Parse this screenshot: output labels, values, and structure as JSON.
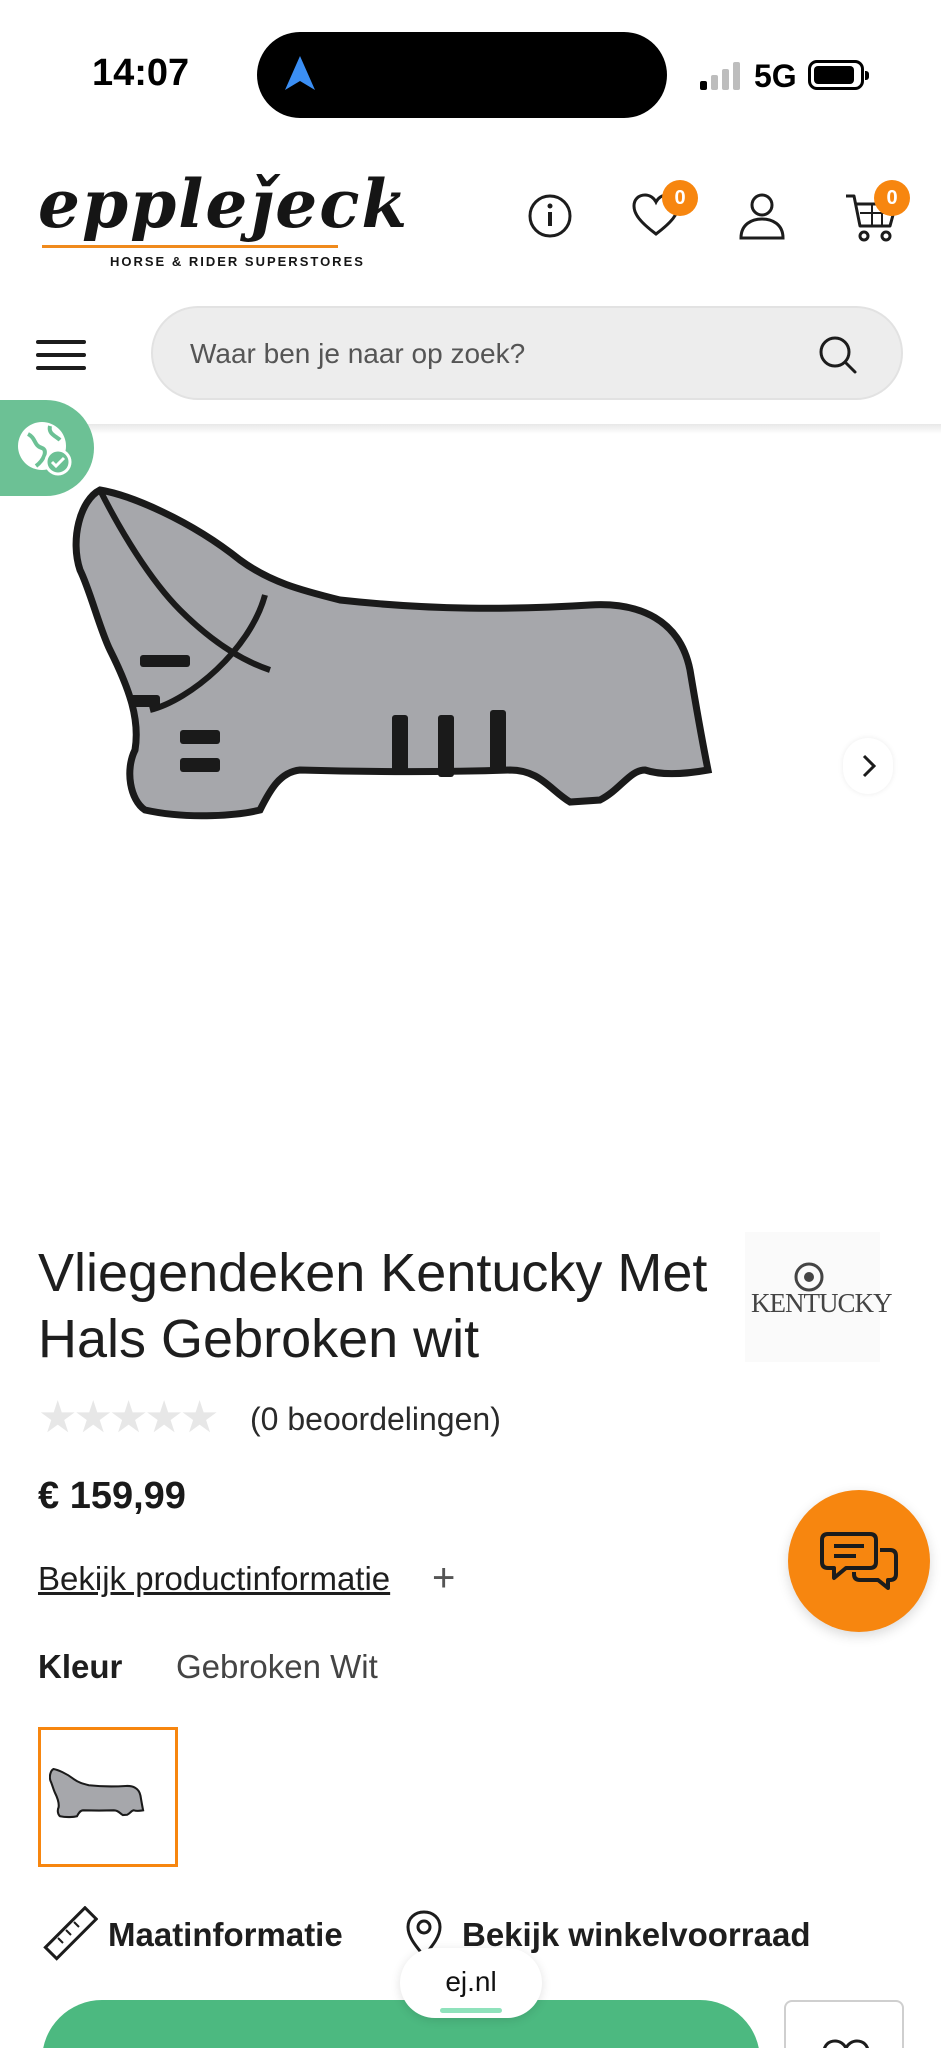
{
  "status_bar": {
    "time": "14:07",
    "network": "5G",
    "icons": [
      "location-arrow-icon",
      "signal-icon",
      "battery-icon"
    ]
  },
  "header": {
    "logo_text": "eppleǰeck",
    "logo_tagline": "HORSE & RIDER SUPERSTORES",
    "wishlist_count": "0",
    "cart_count": "0",
    "icons": [
      "info-icon",
      "heart-icon",
      "user-icon",
      "cart-icon"
    ],
    "accent_color": "#f7860f"
  },
  "search": {
    "placeholder": "Waar ben je naar op zoek?"
  },
  "product": {
    "title": "Vliegendeken Kentucky Met Hals Gebroken wit",
    "brand": "KENTUCKY",
    "reviews": "(0 beoordelingen)",
    "rating_stars": 0,
    "rating_max": 5,
    "price": "€ 159,99",
    "info_link": "Bekijk productinformatie",
    "color_label": "Kleur",
    "color_value": "Gebroken Wit",
    "size_info": "Maatinformatie",
    "stock_info": "Bekijk winkelvoorraad",
    "cta_color": "#4cb980"
  },
  "browser": {
    "url": "ej.nl"
  }
}
